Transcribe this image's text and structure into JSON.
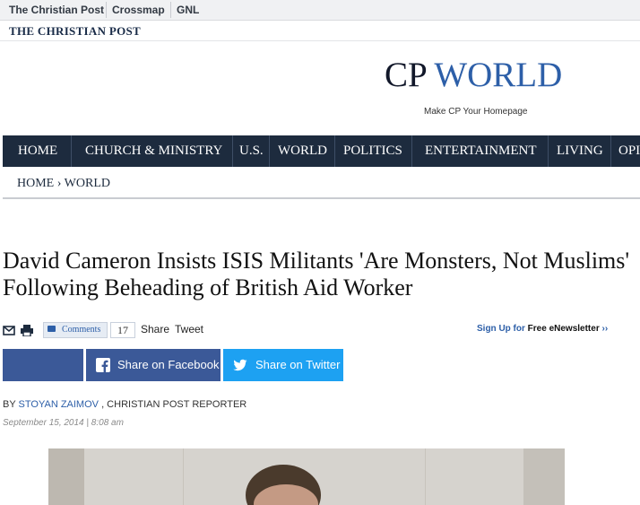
{
  "topbar": {
    "links": [
      "The Christian Post",
      "Crossmap",
      "GNL"
    ]
  },
  "brand": "THE CHRISTIAN POST",
  "section": {
    "prefix": "CP",
    "name": "WORLD",
    "homepage_link": "Make CP Your Homepage"
  },
  "nav": {
    "items": [
      "HOME",
      "CHURCH & MINISTRY",
      "U.S.",
      "WORLD",
      "POLITICS",
      "ENTERTAINMENT",
      "LIVING",
      "OPI"
    ]
  },
  "breadcrumb": {
    "home": "HOME",
    "separator": "›",
    "current": "WORLD"
  },
  "article": {
    "headline": "David Cameron Insists ISIS Militants 'Are Monsters, Not Muslims' Following Beheading of British Aid Worker",
    "byline_prefix": "BY",
    "author": "STOYAN ZAIMOV",
    "author_role": ", CHRISTIAN POST REPORTER",
    "date": "September 15, 2014",
    "time_separator": "|",
    "time": "8:08 am"
  },
  "share": {
    "comments_label": "Comments",
    "comments_count": "17",
    "share_label": "Share",
    "tweet_label": "Tweet",
    "facebook_button": "Share on Facebook",
    "twitter_button": "Share on Twitter"
  },
  "newsletter": {
    "link": "Sign Up for",
    "name": "Free eNewsletter",
    "arrows": "››"
  },
  "icons": {
    "email": "email-icon",
    "print": "print-icon",
    "comment": "comment-bubble-icon",
    "facebook": "facebook-icon",
    "twitter": "twitter-icon"
  },
  "colors": {
    "nav_background": "#1d2b3e",
    "link_blue": "#2d5fa8",
    "facebook": "#3b5998",
    "twitter": "#1da1f2"
  }
}
